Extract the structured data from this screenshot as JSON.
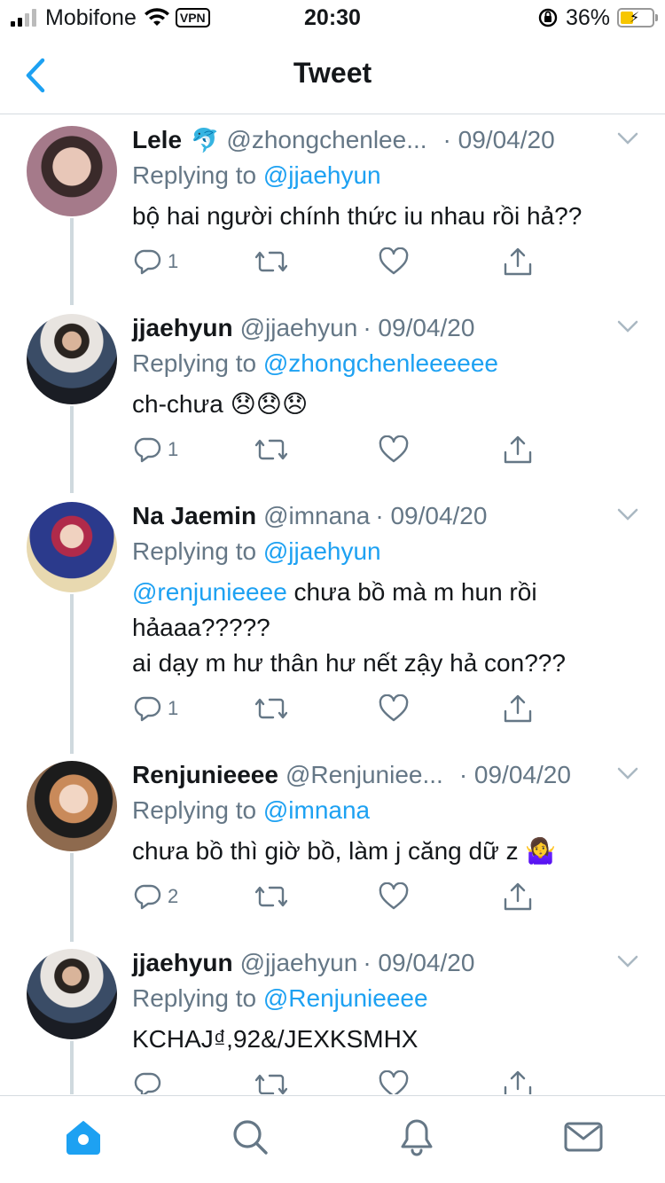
{
  "status_bar": {
    "carrier": "Mobifone",
    "vpn": "VPN",
    "time": "20:30",
    "battery": "36%",
    "battery_level": 0.36
  },
  "nav": {
    "title": "Tweet"
  },
  "tweets": [
    {
      "name": "Lele",
      "name_emoji": "🐬",
      "handle": "@zhongchenlee...",
      "date": "· 09/04/20",
      "reply_prefix": "Replying to",
      "reply_to": "@jjaehyun",
      "text_lines": [
        "bộ hai người chính thức iu nhau rồi hả??"
      ],
      "reply_count": "1"
    },
    {
      "name": "jjaehyun",
      "handle": "@jjaehyun",
      "date": "· 09/04/20",
      "reply_prefix": "Replying to",
      "reply_to": "@zhongchenleeeeee",
      "text_lines": [
        "ch-chưa 😞😞😞"
      ],
      "reply_count": "1"
    },
    {
      "name": "Na Jaemin",
      "handle": "@imnana",
      "date": "· 09/04/20",
      "reply_prefix": "Replying to",
      "reply_to": "@jjaehyun",
      "mention": "@renjunieeee",
      "text_lines": [
        " chưa bồ mà m hun rồi",
        "hảaaa?????",
        "ai dạy m hư thân hư nết zậy hả con???"
      ],
      "reply_count": "1"
    },
    {
      "name": "Renjunieeee",
      "handle": "@Renjuniee...",
      "date": "· 09/04/20",
      "reply_prefix": "Replying to",
      "reply_to": "@imnana",
      "text_lines": [
        "chưa bồ thì giờ bồ, làm j căng dữ z 🤷‍♀️"
      ],
      "reply_count": "2"
    },
    {
      "name": "jjaehyun",
      "handle": "@jjaehyun",
      "date": "· 09/04/20",
      "reply_prefix": "Replying to",
      "reply_to": "@Renjunieeee",
      "text_lines": [
        "KCHAJ₫,92&/JEXKSMHX"
      ],
      "reply_count": ""
    }
  ],
  "tabbar": {
    "items": [
      "home-icon",
      "search-icon",
      "notifications-icon",
      "messages-icon"
    ]
  },
  "colors": {
    "accent": "#1da1f2",
    "muted": "#657786",
    "text": "#14171a"
  }
}
